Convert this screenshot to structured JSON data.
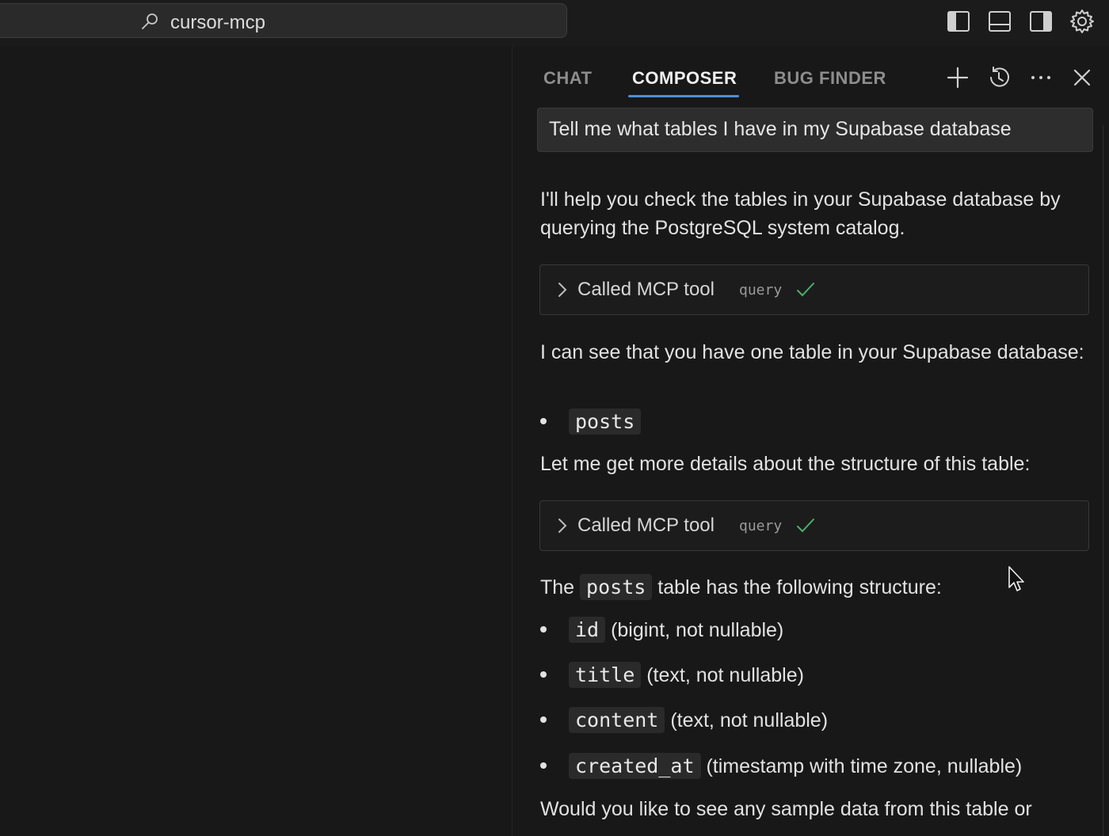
{
  "topbar": {
    "search_text": "cursor-mcp",
    "icons": [
      "toggle-primary-sidebar-icon",
      "toggle-panel-icon",
      "toggle-secondary-sidebar-icon",
      "gear-icon"
    ]
  },
  "panel": {
    "tabs": [
      {
        "label": "CHAT",
        "active": false
      },
      {
        "label": "COMPOSER",
        "active": true
      },
      {
        "label": "BUG FINDER",
        "active": false
      }
    ],
    "header_icons": [
      "plus-icon",
      "history-icon",
      "more-icon",
      "close-icon"
    ],
    "accent_color": "#4c8fd6",
    "user_message": "Tell me what tables I have in my Supabase database",
    "assistant": {
      "intro": "I'll help you check the tables in your Supabase database by querying the PostgreSQL system catalog.",
      "tool_call_1": {
        "label": "Called MCP tool",
        "badge": "query"
      },
      "found_text": "I can see that you have one table in your Supabase database:",
      "table_name": "posts",
      "details_text": "Let me get more details about the structure of this table:",
      "tool_call_2": {
        "label": "Called MCP tool",
        "badge": "query"
      },
      "structure_prefix": "The",
      "structure_table": "posts",
      "structure_suffix": "table has the following structure:",
      "columns": [
        {
          "name": "id",
          "desc": "(bigint, not nullable)"
        },
        {
          "name": "title",
          "desc": "(text, not nullable)"
        },
        {
          "name": "content",
          "desc": "(text, not nullable)"
        },
        {
          "name": "created_at",
          "desc": "(timestamp with time zone, nullable)"
        }
      ],
      "closing_text": "Would you like to see any sample data from this table or"
    }
  }
}
